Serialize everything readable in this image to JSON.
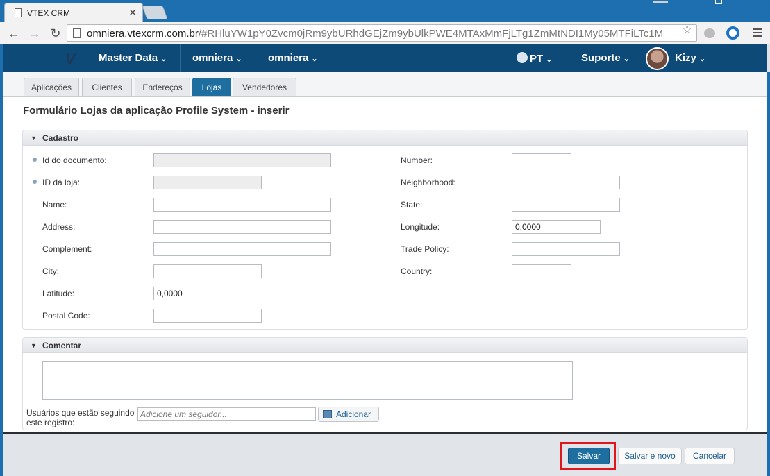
{
  "browser": {
    "tab_title": "VTEX CRM",
    "tab_close": "✕",
    "url_host": "omniera.vtexcrm.com.br",
    "url_rest": "/#RHluYW1pY0Zvcm0jRm9ybURhdGEjZm9ybUlkPWE4MTAxMmFjLTg1ZmMtNDI1My05MTFiLTc1M",
    "back_icon": "←",
    "forward_icon": "→",
    "reload_icon": "↻",
    "star_icon": "☆"
  },
  "appbar": {
    "logo": "V",
    "master_data": "Master Data",
    "crumb1": "omniera",
    "crumb2": "omniera",
    "language": "PT",
    "support": "Suporte",
    "user": "Kizy",
    "caret": "⌄"
  },
  "tabs": {
    "items": [
      "Aplicações",
      "Clientes",
      "Endereços",
      "Lojas",
      "Vendedores"
    ],
    "active": "Lojas"
  },
  "page": {
    "title": "Formulário Lojas da aplicação Profile System - inserir"
  },
  "cadastro": {
    "header": "Cadastro",
    "arrow": "▼",
    "left": {
      "id_documento": {
        "label": "Id do documento:",
        "value": ""
      },
      "id_loja": {
        "label": "ID da loja:",
        "value": ""
      },
      "name": {
        "label": "Name:",
        "value": ""
      },
      "address": {
        "label": "Address:",
        "value": ""
      },
      "complement": {
        "label": "Complement:",
        "value": ""
      },
      "city": {
        "label": "City:",
        "value": ""
      },
      "latitude": {
        "label": "Latitude:",
        "value": "0,0000"
      },
      "postal_code": {
        "label": "Postal Code:",
        "value": ""
      }
    },
    "right": {
      "number": {
        "label": "Number:",
        "value": ""
      },
      "neighborhood": {
        "label": "Neighborhood:",
        "value": ""
      },
      "state": {
        "label": "State:",
        "value": ""
      },
      "longitude": {
        "label": "Longitude:",
        "value": "0,0000"
      },
      "trade_policy": {
        "label": "Trade Policy:",
        "value": ""
      },
      "country": {
        "label": "Country:",
        "value": ""
      }
    }
  },
  "comentar": {
    "header": "Comentar",
    "arrow": "▼",
    "comment_value": "",
    "followers_label_line1": "Usuários que estão seguindo",
    "followers_label_line2": "este registro:",
    "follower_placeholder": "Adicione um seguidor...",
    "add_button": "Adicionar"
  },
  "footer": {
    "save": "Salvar",
    "save_new": "Salvar e novo",
    "cancel": "Cancelar"
  },
  "colors": {
    "brand_dark": "#0e4a78",
    "primary_button": "#1e6fa0",
    "highlight_border": "#e0161d"
  }
}
